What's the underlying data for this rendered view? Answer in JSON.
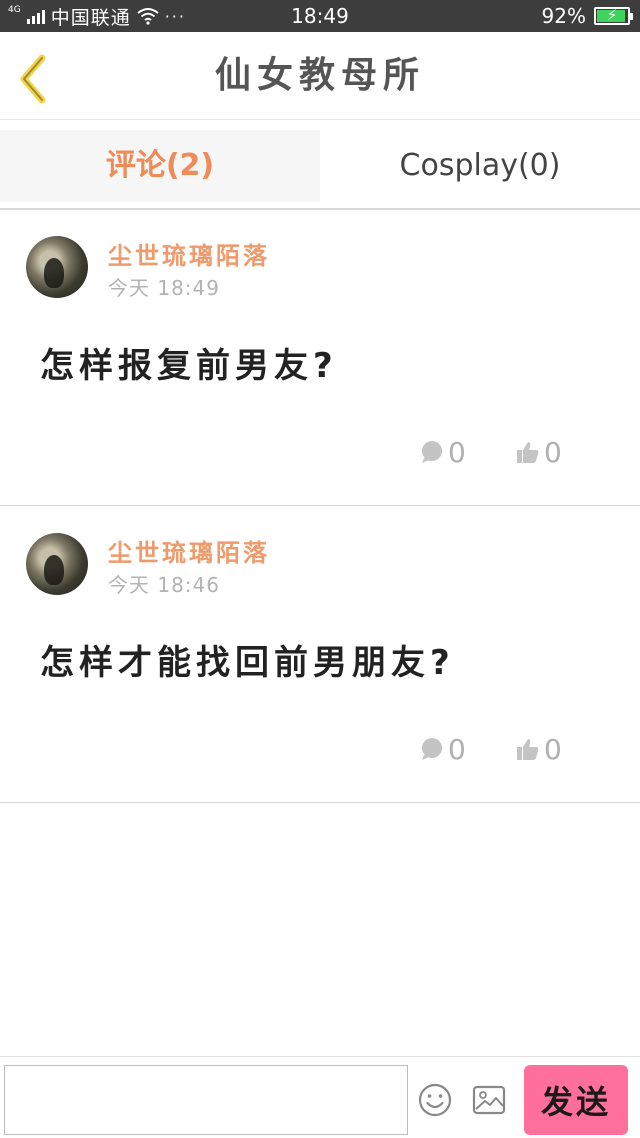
{
  "status_bar": {
    "network": "4G",
    "carrier": "中国联通",
    "dots": "···",
    "time": "18:49",
    "battery": "92%",
    "battery_level": 0.92
  },
  "header": {
    "title": "仙女教母所",
    "back_icon": "chevron-left-icon"
  },
  "tabs": [
    {
      "label": "评论(2)",
      "active": true
    },
    {
      "label": "Cosplay(0)",
      "active": false
    }
  ],
  "comments": [
    {
      "author": "尘世琉璃陌落",
      "time": "今天 18:49",
      "text": "怎样报复前男友?",
      "reply_count": "0",
      "like_count": "0"
    },
    {
      "author": "尘世琉璃陌落",
      "time": "今天 18:46",
      "text": "怎样才能找回前男朋友?",
      "reply_count": "0",
      "like_count": "0"
    }
  ],
  "input_bar": {
    "placeholder": "",
    "emoji_icon": "smiley-icon",
    "image_icon": "image-icon",
    "send_label": "发送"
  },
  "colors": {
    "accent": "#f08a56",
    "author": "#ee9a6b",
    "send_button": "#ff6f9c",
    "status_bar": "#3d3d3d"
  }
}
